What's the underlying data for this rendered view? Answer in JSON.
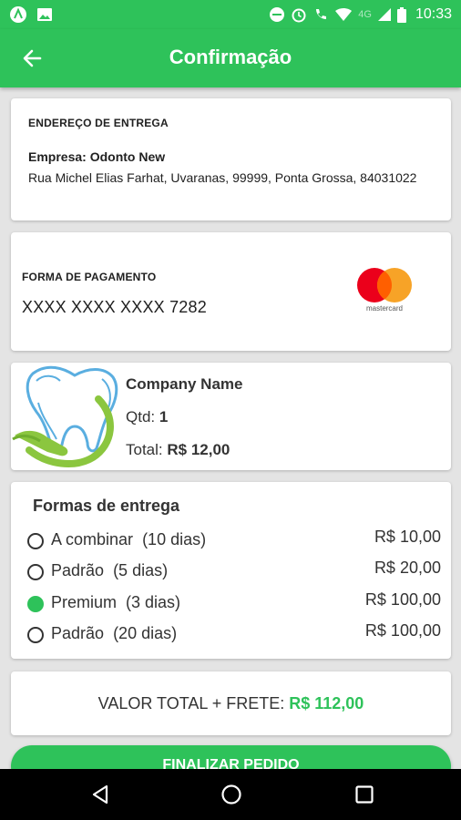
{
  "status_bar": {
    "time": "10:33",
    "network": "4G",
    "icons": [
      "app-icon",
      "image-icon",
      "do-not-disturb-icon",
      "alarm-icon",
      "phone-signal-icon",
      "wifi-icon",
      "cell-signal-icon",
      "battery-icon"
    ]
  },
  "app_bar": {
    "title": "Confirmação",
    "back_icon": "arrow-left-icon"
  },
  "address": {
    "label": "ENDEREÇO DE ENTREGA",
    "company": "Empresa: Odonto New",
    "address": "Rua Michel Elias Farhat, Uvaranas, 99999, Ponta Grossa, 84031022"
  },
  "payment": {
    "label": "FORMA DE PAGAMENTO",
    "card_number": "XXXX XXXX XXXX 7282",
    "brand": "mastercard",
    "brand_colors": [
      "#eb001b",
      "#f79e1b",
      "#ff5f00"
    ]
  },
  "product": {
    "name": "Company Name",
    "qty_label": "Qtd:",
    "qty_value": "1",
    "total_label": "Total:",
    "total_value": "R$ 12,00"
  },
  "delivery": {
    "title": "Formas de entrega",
    "options": [
      {
        "label": "A combinar",
        "days": "(10 dias)",
        "price": "R$ 10,00",
        "selected": false
      },
      {
        "label": "Padrão",
        "days": "(5 dias)",
        "price": "R$ 20,00",
        "selected": false
      },
      {
        "label": "Premium",
        "days": "(3 dias)",
        "price": "R$ 100,00",
        "selected": true
      },
      {
        "label": "Padrão",
        "days": "(20 dias)",
        "price": "R$ 100,00",
        "selected": false
      }
    ]
  },
  "total": {
    "label": "VALOR TOTAL + FRETE:",
    "value": "R$ 112,00"
  },
  "finalize_button": {
    "label": "FINALIZAR PEDIDO"
  },
  "colors": {
    "primary": "#2ec25a",
    "background": "#e4e4e4"
  }
}
